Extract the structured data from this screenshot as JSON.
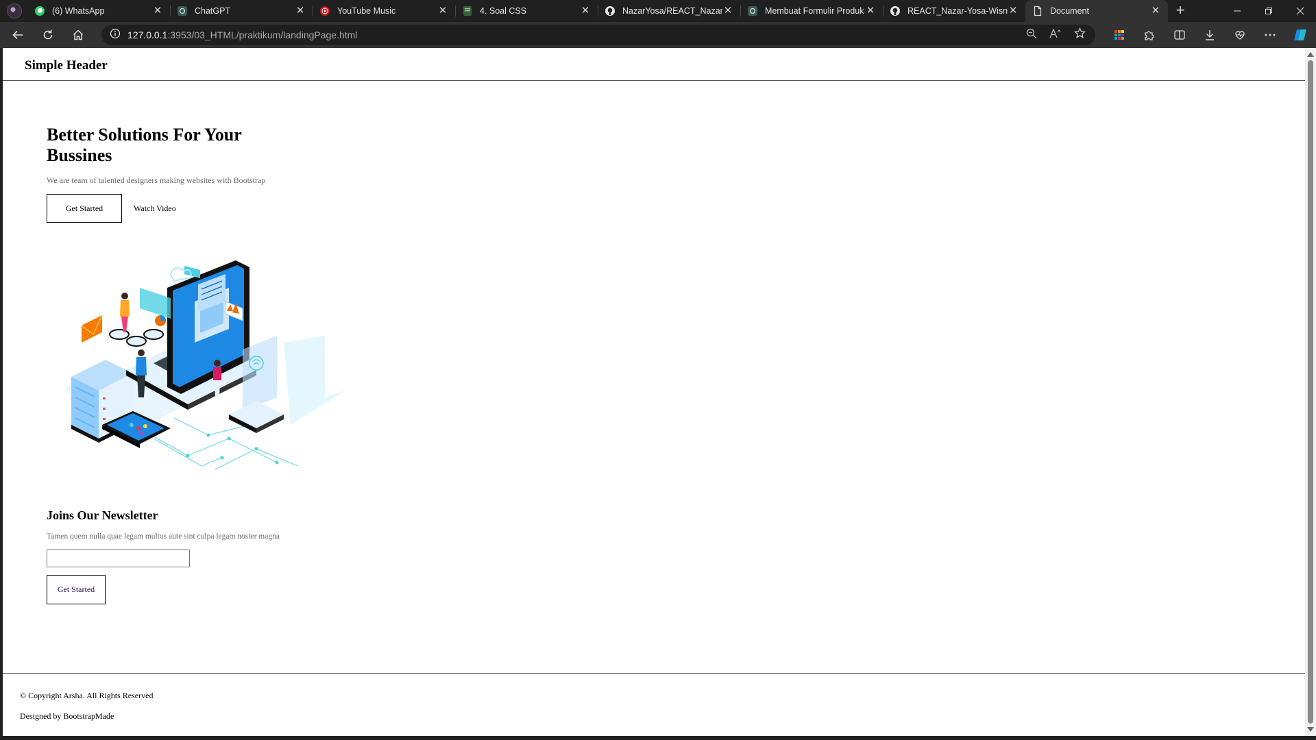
{
  "browser": {
    "tabs": [
      {
        "title": "(6) WhatsApp",
        "icon": "whatsapp-icon"
      },
      {
        "title": "ChatGPT",
        "icon": "chatgpt-icon"
      },
      {
        "title": "YouTube Music",
        "icon": "youtube-music-icon"
      },
      {
        "title": "4. Soal CSS",
        "icon": "document-icon"
      },
      {
        "title": "NazarYosa/REACT_Nazar-Y",
        "icon": "github-icon"
      },
      {
        "title": "Membuat Formulir Produk",
        "icon": "chatgpt-icon"
      },
      {
        "title": "REACT_Nazar-Yosa-Wisnu-",
        "icon": "github-icon"
      },
      {
        "title": "Document",
        "icon": "page-icon"
      }
    ],
    "url_host": "127.0.0.1",
    "url_rest": ":3953/03_HTML/praktikum/landingPage.html"
  },
  "page": {
    "header_title": "Simple Header",
    "hero": {
      "title": "Better Solutions For Your Bussines",
      "subtitle": "We are team of talented designers making websites with Bootstrap",
      "primary_button": "Get Started",
      "secondary_link": "Watch Video"
    },
    "newsletter": {
      "title": "Joins Our Newsletter",
      "text": "Tamen quem nulla quae legam multos aute sint culpa legam noster magna",
      "input_value": "",
      "button": "Get Started"
    },
    "footer": {
      "copyright": "© Copyright Arsha. All Rights Reserved",
      "credit": "Designed by BootstrapMade"
    }
  },
  "colors": {
    "chrome_dark": "#202020",
    "toolbar": "#323232",
    "illustration_blue": "#1e88e5",
    "illustration_cyan": "#4dd0e1"
  }
}
